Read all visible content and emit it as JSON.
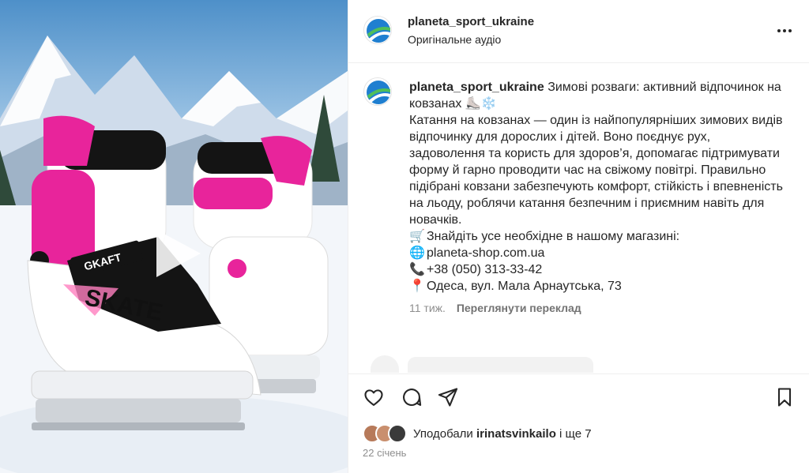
{
  "header": {
    "username": "planeta_sport_ukraine",
    "audio": "Оригінальне аудіо"
  },
  "media": {
    "skate_brand": "SKATE",
    "skate_model": "GKAFT"
  },
  "caption": {
    "username": "planeta_sport_ukraine",
    "title": "Зимові розваги: активний відпочинок на ковзанах ⛸️❄️",
    "body": "Катання на ковзанах — один із найпопулярніших зимових видів відпочинку для дорослих і дітей. Воно поєднує рух, задоволення та користь для здоров’я, допомагає підтримувати форму й гарно проводити час на свіжому повітрі. Правильно підібрані ковзани забезпечують комфорт, стійкість і впевненість на льоду, роблячи катання безпечним і приємним навіть для новачків.",
    "shop_line": "Знайдіть усе необхідне в нашому магазині:",
    "website": "planeta-shop.com.ua",
    "phone": "+38 (050) 313-33-42",
    "address": "Одеса, вул. Мала Арнаутська, 73"
  },
  "meta": {
    "time_ago": "11 тиж.",
    "translate": "Переглянути переклад"
  },
  "likes": {
    "prefix": "Уподобали",
    "user": "irinatsvinkailo",
    "suffix": "і ще 7"
  },
  "date": "22 січень",
  "icons": {
    "shop": "shopping-cart-icon",
    "web": "globe-icon",
    "phone": "phone-icon",
    "location": "pin-icon"
  },
  "colors": {
    "skate_pink": "#e8249b",
    "text": "#262626",
    "muted": "#8e8e8e"
  }
}
